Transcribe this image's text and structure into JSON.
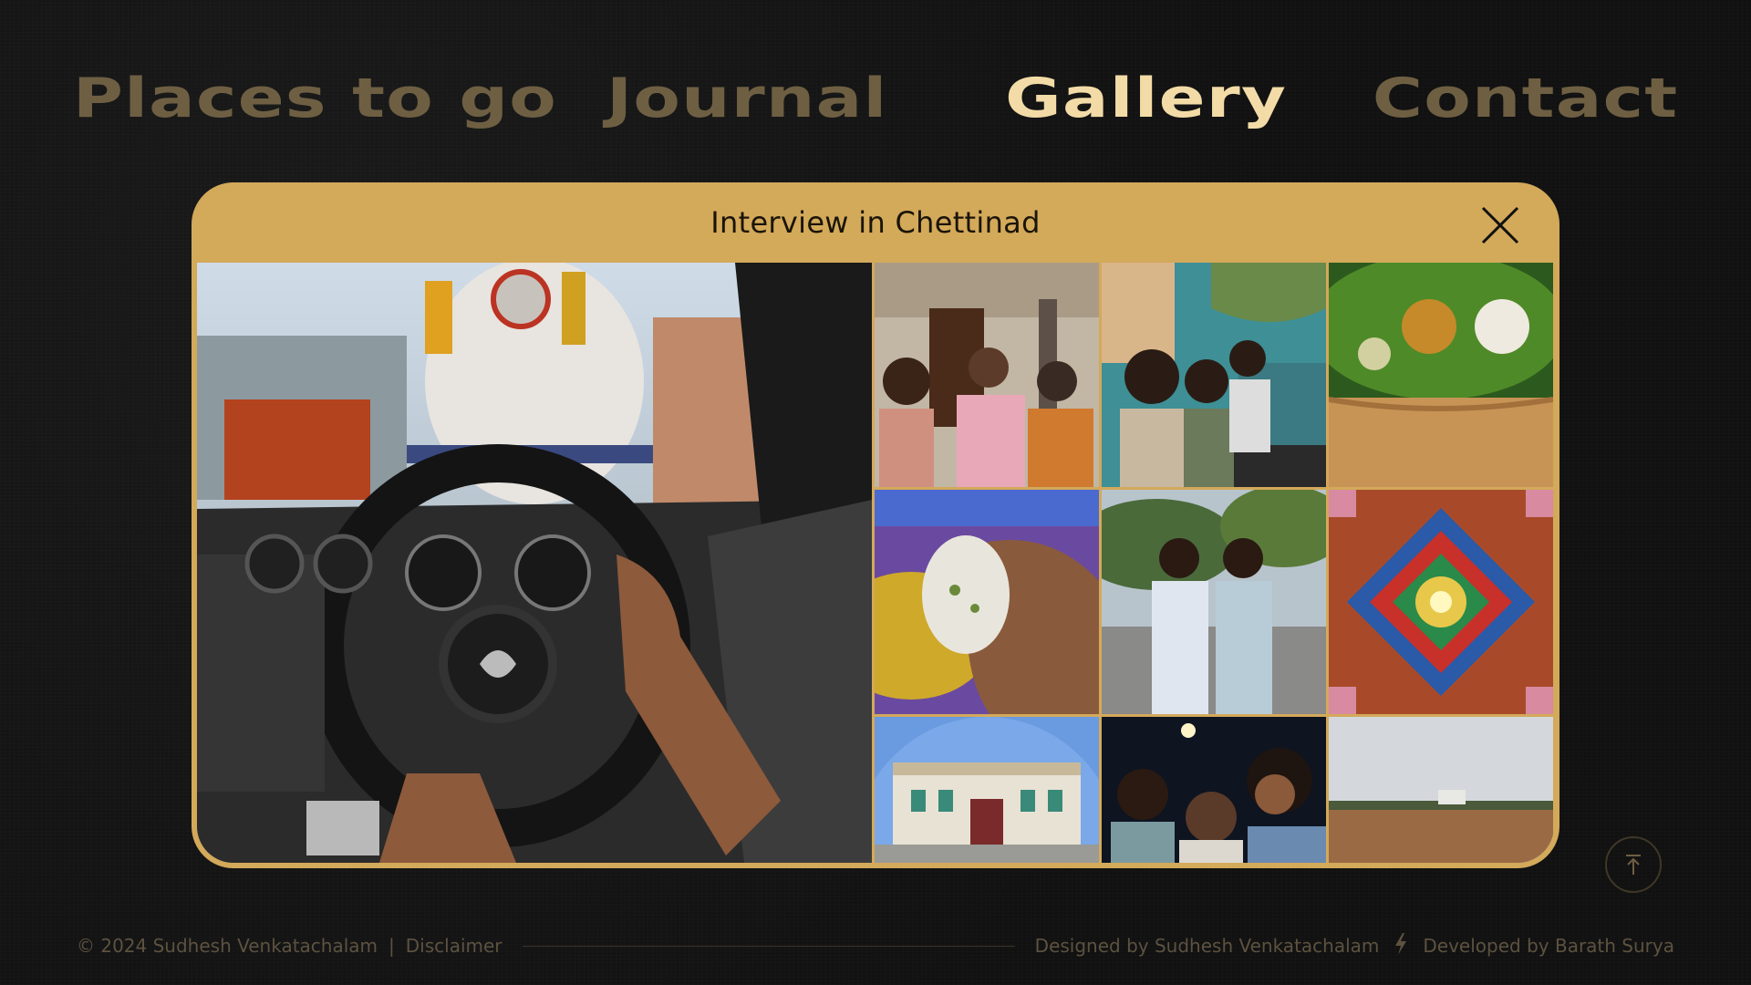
{
  "nav": {
    "items": [
      {
        "label": "Places to go"
      },
      {
        "label": "Journal"
      },
      {
        "label": "Gallery"
      },
      {
        "label": "Contact"
      }
    ],
    "active": "Gallery"
  },
  "modal": {
    "title": "Interview in Chettinad",
    "close_icon": "close-icon"
  },
  "gallery": {
    "photos": [
      {
        "subject": "car-dashboard-driving"
      },
      {
        "subject": "three-people-in-chettinad-house"
      },
      {
        "subject": "friends-selfie-in-cafe"
      },
      {
        "subject": "food-on-banana-leaf-and-dosa"
      },
      {
        "subject": "hand-holding-food"
      },
      {
        "subject": "two-men-standing-outdoors"
      },
      {
        "subject": "painted-ceiling"
      },
      {
        "subject": "chettinad-mansion-fisheye"
      },
      {
        "subject": "night-group-selfie"
      },
      {
        "subject": "open-field-landscape"
      }
    ]
  },
  "back_to_top_icon": "arrow-up-icon",
  "footer": {
    "copyright": "© 2024 Sudhesh Venkatachalam",
    "separator": "|",
    "disclaimer": "Disclaimer",
    "designed": "Designed by Sudhesh Venkatachalam",
    "bolt_icon": "bolt-icon",
    "developed": "Developed by Barath Surya"
  },
  "colors": {
    "background": "#121212",
    "accent": "#d3a95a",
    "nav_active": "#f2dba6",
    "nav_inactive": "#6e5f43"
  }
}
